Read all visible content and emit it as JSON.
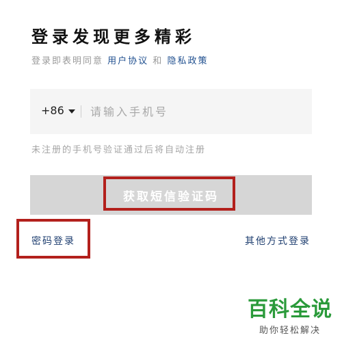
{
  "header": {
    "title": "登录发现更多精彩"
  },
  "agreement": {
    "prefix": "登录即表明同意 ",
    "user_agreement_link": "用户协议",
    "conjunction": " 和 ",
    "privacy_policy_link": "隐私政策",
    "link_color": "#1f4f8f"
  },
  "phone_field": {
    "country_code": "+86",
    "country_dropdown_icon": "caret-down-icon",
    "placeholder": "请输入手机号",
    "value": ""
  },
  "hint": "未注册的手机号验证通过后将自动注册",
  "get_code_button": {
    "label": "获取短信验证码",
    "background": "#d6d6d6",
    "highlight_color": "#b3201c"
  },
  "footer_links": {
    "password_login": "密码登录",
    "other_login": "其他方式登录",
    "link_color": "#1f3f70"
  },
  "watermark": {
    "main": "百科全说",
    "sub": "助你轻松解决",
    "color": "#2a9a3a"
  }
}
